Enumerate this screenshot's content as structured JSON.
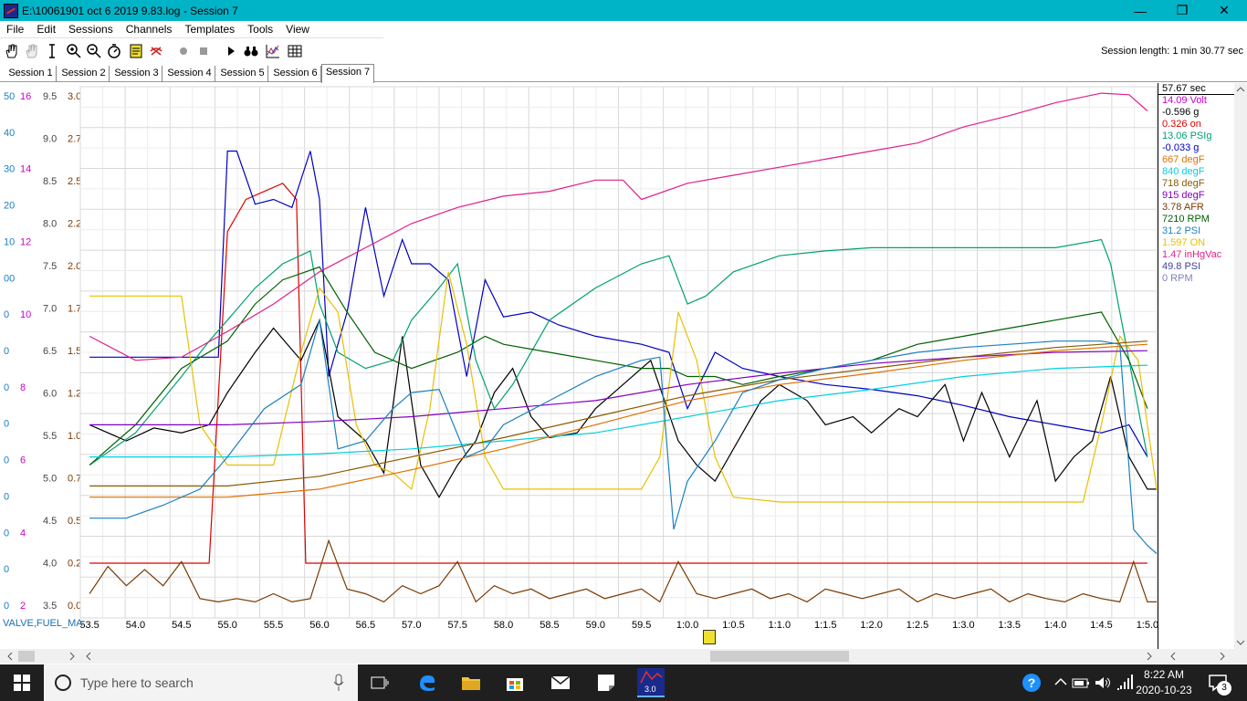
{
  "window": {
    "title": "E:\\10061901 oct 6 2019 9.83.log - Session 7",
    "min": "—",
    "max": "❐",
    "close": "✕"
  },
  "menu": [
    "File",
    "Edit",
    "Sessions",
    "Channels",
    "Templates",
    "Tools",
    "View"
  ],
  "toolbar": {
    "icons": [
      "hand-icon",
      "hand-disabled-icon",
      "cursor-icon",
      "zoom-in-icon",
      "zoom-out-icon",
      "stopwatch-icon",
      "note-icon",
      "clear-icon",
      "record-icon",
      "stop-icon",
      "play-icon",
      "binoculars-icon",
      "chart-icon",
      "table-icon"
    ],
    "session_length": "Session length:  1 min 30.77 sec"
  },
  "tabs": [
    "Session 1",
    "Session 2",
    "Session 3",
    "Session 4",
    "Session 5",
    "Session 6",
    "Session 7"
  ],
  "active_tab": 6,
  "legend": {
    "header": "57.67 sec",
    "entries": [
      {
        "text": "14.09 Volt",
        "color": "#cc00cc"
      },
      {
        "text": "-0.596 g",
        "color": "#000000"
      },
      {
        "text": "0.326 on",
        "color": "#dd0000"
      },
      {
        "text": "13.06 PSIg",
        "color": "#00a070"
      },
      {
        "text": "-0.033 g",
        "color": "#0000c0"
      },
      {
        "text": "667 degF",
        "color": "#e07000"
      },
      {
        "text": "840 degF",
        "color": "#00d0e0"
      },
      {
        "text": "718 degF",
        "color": "#8b5a00"
      },
      {
        "text": "915 degF",
        "color": "#8000c0"
      },
      {
        "text": "3.78 AFR",
        "color": "#7a3a00"
      },
      {
        "text": "7210 RPM",
        "color": "#006000"
      },
      {
        "text": "31.2 PSI",
        "color": "#1a80c0"
      },
      {
        "text": "1.597 ON",
        "color": "#e8c000"
      },
      {
        "text": "1.47 inHgVac",
        "color": "#e0208a"
      },
      {
        "text": "49.8 PSI",
        "color": "#4040a0"
      },
      {
        "text": "0 RPM",
        "color": "#8080c0"
      }
    ]
  },
  "channel_label": "VALVE,FUEL_MA",
  "chart_data": {
    "type": "line",
    "x_ticks": [
      "53.5",
      "54.0",
      "54.5",
      "55.0",
      "55.5",
      "56.0",
      "56.5",
      "57.0",
      "57.5",
      "58.0",
      "58.5",
      "59.0",
      "59.5",
      "1:0.0",
      "1:0.5",
      "1:1.0",
      "1:1.5",
      "1:2.0",
      "1:2.5",
      "1:3.0",
      "1:3.5",
      "1:4.0",
      "1:4.5",
      "1:5.0"
    ],
    "xlim": [
      53.4,
      65.1
    ],
    "axes": [
      {
        "color": "#1a80c0",
        "ticks": [
          "50",
          "40",
          "30",
          "20",
          "10",
          "00",
          "0",
          "0",
          "0",
          "0",
          "0",
          "0",
          "0",
          "0",
          "0"
        ]
      },
      {
        "color": "#cc00cc",
        "ticks": [
          "16",
          "14",
          "12",
          "10",
          "8",
          "6",
          "4",
          "2"
        ]
      },
      {
        "color": "#444444",
        "ticks": [
          "9.5",
          "9.0",
          "8.5",
          "8.0",
          "7.5",
          "7.0",
          "6.5",
          "6.0",
          "5.5",
          "5.0",
          "4.5",
          "4.0",
          "3.5"
        ]
      },
      {
        "color": "#7a3a00",
        "ticks": [
          "3.0",
          "2.7",
          "2.5",
          "2.2",
          "2.0",
          "1.7",
          "1.5",
          "1.2",
          "1.0",
          "0.7",
          "0.5",
          "0.2",
          "0.0"
        ]
      }
    ],
    "series": [
      {
        "color": "#cc00cc",
        "x": [
          53.5,
          54.0,
          55.0,
          56.0,
          57.0,
          57.5,
          58.0,
          59.0,
          59.5,
          60.0,
          61.0,
          62.0,
          63.0,
          64.0,
          64.5,
          65.0
        ],
        "y": [
          14.1,
          14.1,
          14.1,
          14.1,
          14.1,
          14.1,
          14.1,
          14.1,
          14.1,
          14.1,
          14.1,
          14.1,
          14.1,
          14.1,
          14.1,
          14.1
        ]
      },
      {
        "color": "#dd0000",
        "x": [
          53.5,
          54.5,
          54.8,
          55.0,
          55.2,
          55.6,
          55.75,
          55.85,
          56.0,
          57.0,
          58.0,
          59.0,
          60.0,
          61.0,
          62.0,
          63.0,
          64.0,
          65.0
        ],
        "y": [
          0.34,
          0.34,
          0.34,
          2.4,
          2.6,
          2.7,
          2.6,
          0.34,
          0.34,
          0.34,
          0.34,
          0.34,
          0.34,
          0.34,
          0.34,
          0.34,
          0.34,
          0.34
        ]
      },
      {
        "color": "#0000c0",
        "x": [
          53.5,
          54.5,
          54.9,
          55.0,
          55.1,
          55.3,
          55.5,
          55.7,
          55.9,
          56.0,
          56.1,
          56.3,
          56.5,
          56.7,
          56.9,
          57.0,
          57.2,
          57.4,
          57.6,
          57.8,
          58.0,
          58.3,
          58.6,
          59.0,
          59.5,
          59.8,
          60.0,
          60.3,
          60.6,
          61.0,
          61.5,
          62.0,
          62.5,
          63.0,
          63.5,
          64.0,
          64.5,
          64.8,
          65.0
        ],
        "y": [
          1.62,
          1.62,
          1.62,
          2.9,
          2.9,
          2.57,
          2.6,
          2.55,
          2.9,
          2.6,
          1.5,
          1.9,
          2.55,
          2.0,
          2.35,
          2.2,
          2.2,
          2.1,
          1.5,
          2.1,
          1.87,
          1.9,
          1.82,
          1.75,
          1.7,
          1.65,
          1.3,
          1.65,
          1.55,
          1.5,
          1.45,
          1.42,
          1.38,
          1.32,
          1.25,
          1.2,
          1.15,
          1.2,
          1.0
        ]
      },
      {
        "color": "#000000",
        "x": [
          53.5,
          53.9,
          54.2,
          54.5,
          54.8,
          55.0,
          55.3,
          55.5,
          55.8,
          56.0,
          56.2,
          56.5,
          56.7,
          56.9,
          57.1,
          57.3,
          57.5,
          57.7,
          57.9,
          58.1,
          58.3,
          58.5,
          58.8,
          59.0,
          59.3,
          59.6,
          59.9,
          60.1,
          60.3,
          60.6,
          60.8,
          61.0,
          61.3,
          61.5,
          61.8,
          62.0,
          62.3,
          62.5,
          62.8,
          63.0,
          63.2,
          63.5,
          63.8,
          64.0,
          64.2,
          64.4,
          64.6,
          64.8,
          65.0,
          65.1
        ],
        "y": [
          1.2,
          1.1,
          1.18,
          1.15,
          1.2,
          1.4,
          1.65,
          1.8,
          1.6,
          1.85,
          1.25,
          1.1,
          0.9,
          1.75,
          0.95,
          0.75,
          0.95,
          1.1,
          1.4,
          1.55,
          1.25,
          1.12,
          1.15,
          1.3,
          1.45,
          1.6,
          1.1,
          0.95,
          0.85,
          1.15,
          1.35,
          1.45,
          1.35,
          1.2,
          1.25,
          1.15,
          1.3,
          1.25,
          1.45,
          1.1,
          1.4,
          1.0,
          1.35,
          0.85,
          1.0,
          1.1,
          1.5,
          1.0,
          0.8,
          0.8
        ]
      },
      {
        "color": "#00a070",
        "x": [
          53.5,
          54.0,
          54.5,
          54.8,
          55.0,
          55.3,
          55.6,
          55.9,
          56.0,
          56.2,
          56.5,
          56.8,
          57.0,
          57.3,
          57.5,
          57.7,
          57.9,
          58.1,
          58.5,
          59.0,
          59.5,
          59.8,
          60.0,
          60.2,
          60.5,
          61.0,
          61.5,
          62.0,
          62.5,
          63.0,
          63.5,
          64.0,
          64.5,
          64.6,
          64.8,
          65.0
        ],
        "y": [
          0.95,
          1.15,
          1.5,
          1.72,
          1.85,
          2.05,
          2.2,
          2.28,
          1.95,
          1.65,
          1.55,
          1.6,
          1.85,
          2.05,
          2.2,
          1.6,
          1.3,
          1.45,
          1.85,
          2.05,
          2.2,
          2.25,
          1.95,
          2.0,
          2.15,
          2.25,
          2.28,
          2.3,
          2.3,
          2.3,
          2.3,
          2.3,
          2.35,
          2.2,
          1.6,
          1.0
        ]
      },
      {
        "color": "#006000",
        "x": [
          53.5,
          54.0,
          54.5,
          55.0,
          55.3,
          55.6,
          56.0,
          56.3,
          56.6,
          57.0,
          57.5,
          57.8,
          58.0,
          58.5,
          59.0,
          59.5,
          59.8,
          60.0,
          60.3,
          60.6,
          61.0,
          61.5,
          62.0,
          62.5,
          63.0,
          63.5,
          64.0,
          64.5,
          64.8,
          65.0
        ],
        "y": [
          0.95,
          1.2,
          1.55,
          1.72,
          1.95,
          2.1,
          2.18,
          1.9,
          1.65,
          1.55,
          1.65,
          1.75,
          1.7,
          1.65,
          1.6,
          1.55,
          1.55,
          1.5,
          1.5,
          1.45,
          1.5,
          1.55,
          1.6,
          1.7,
          1.75,
          1.8,
          1.85,
          1.9,
          1.6,
          1.3
        ]
      },
      {
        "color": "#e8c000",
        "x": [
          53.5,
          54.0,
          54.5,
          54.7,
          55.0,
          55.5,
          55.8,
          56.0,
          56.2,
          56.4,
          56.6,
          56.8,
          57.0,
          57.2,
          57.4,
          57.6,
          57.8,
          58.0,
          58.5,
          59.0,
          59.5,
          59.7,
          59.9,
          60.1,
          60.3,
          60.5,
          61.0,
          61.5,
          62.0,
          62.5,
          63.0,
          63.5,
          64.0,
          64.3,
          64.5,
          64.7,
          64.9,
          65.0,
          65.1
        ],
        "y": [
          2.0,
          2.0,
          2.0,
          1.2,
          0.95,
          0.95,
          1.65,
          2.05,
          1.9,
          1.2,
          0.95,
          0.9,
          0.8,
          1.3,
          2.15,
          1.7,
          1.0,
          0.8,
          0.8,
          0.8,
          0.8,
          1.0,
          1.9,
          1.6,
          1.0,
          0.75,
          0.72,
          0.72,
          0.72,
          0.72,
          0.72,
          0.72,
          0.72,
          0.72,
          1.2,
          1.75,
          1.6,
          1.2,
          0.8
        ]
      },
      {
        "color": "#e0208a",
        "x": [
          53.5,
          54.0,
          54.5,
          55.0,
          55.5,
          56.0,
          56.5,
          57.0,
          57.5,
          58.0,
          58.5,
          59.0,
          59.3,
          59.5,
          60.0,
          60.5,
          61.0,
          61.5,
          62.0,
          62.5,
          63.0,
          63.5,
          64.0,
          64.5,
          64.8,
          65.0
        ],
        "y": [
          1.75,
          1.6,
          1.62,
          1.78,
          1.95,
          2.15,
          2.3,
          2.45,
          2.55,
          2.62,
          2.65,
          2.72,
          2.72,
          2.6,
          2.7,
          2.75,
          2.8,
          2.85,
          2.9,
          2.95,
          3.05,
          3.12,
          3.2,
          3.26,
          3.25,
          3.15
        ]
      },
      {
        "color": "#8000c0",
        "x": [
          53.5,
          54.0,
          55.0,
          56.0,
          57.0,
          58.0,
          59.0,
          60.0,
          61.0,
          62.0,
          63.0,
          64.0,
          65.0
        ],
        "y": [
          1.2,
          1.2,
          1.2,
          1.22,
          1.25,
          1.3,
          1.35,
          1.45,
          1.52,
          1.58,
          1.62,
          1.65,
          1.66
        ]
      },
      {
        "color": "#00d0e0",
        "x": [
          53.5,
          54.0,
          55.0,
          56.0,
          57.0,
          58.0,
          59.0,
          60.0,
          61.0,
          62.0,
          63.0,
          64.0,
          65.0
        ],
        "y": [
          1.0,
          1.0,
          1.0,
          1.02,
          1.05,
          1.1,
          1.15,
          1.25,
          1.35,
          1.42,
          1.5,
          1.55,
          1.57
        ]
      },
      {
        "color": "#8b5a00",
        "x": [
          53.5,
          54.0,
          55.0,
          56.0,
          57.0,
          58.0,
          59.0,
          60.0,
          61.0,
          62.0,
          63.0,
          64.0,
          65.0
        ],
        "y": [
          0.82,
          0.82,
          0.82,
          0.88,
          1.0,
          1.12,
          1.25,
          1.38,
          1.48,
          1.55,
          1.62,
          1.68,
          1.72
        ]
      },
      {
        "color": "#e07000",
        "x": [
          53.5,
          54.0,
          55.0,
          56.0,
          57.0,
          58.0,
          59.0,
          60.0,
          61.0,
          62.0,
          63.0,
          64.0,
          65.0
        ],
        "y": [
          0.75,
          0.75,
          0.75,
          0.8,
          0.92,
          1.05,
          1.2,
          1.35,
          1.45,
          1.52,
          1.6,
          1.66,
          1.7
        ]
      },
      {
        "color": "#1a80c0",
        "x": [
          53.5,
          53.9,
          54.3,
          54.7,
          55.0,
          55.4,
          55.8,
          56.0,
          56.2,
          56.5,
          56.8,
          57.0,
          57.3,
          57.6,
          57.8,
          58.0,
          58.5,
          59.0,
          59.5,
          59.7,
          59.85,
          60.0,
          60.3,
          60.6,
          61.0,
          61.5,
          62.0,
          62.5,
          63.0,
          63.5,
          64.0,
          64.5,
          64.7,
          64.85,
          65.0,
          65.1
        ],
        "y": [
          0.62,
          0.62,
          0.7,
          0.8,
          1.0,
          1.3,
          1.45,
          1.85,
          1.05,
          1.1,
          1.3,
          1.4,
          1.42,
          1.0,
          1.05,
          1.2,
          1.35,
          1.5,
          1.6,
          1.62,
          0.55,
          0.85,
          1.1,
          1.4,
          1.48,
          1.55,
          1.6,
          1.65,
          1.68,
          1.7,
          1.72,
          1.72,
          1.7,
          0.55,
          0.45,
          0.4
        ]
      },
      {
        "color": "#7a3a00",
        "x": [
          53.5,
          53.7,
          53.9,
          54.1,
          54.3,
          54.5,
          54.7,
          54.9,
          55.1,
          55.3,
          55.5,
          55.7,
          55.9,
          56.1,
          56.3,
          56.5,
          56.7,
          56.9,
          57.1,
          57.3,
          57.5,
          57.7,
          57.9,
          58.1,
          58.3,
          58.5,
          58.7,
          58.9,
          59.1,
          59.3,
          59.5,
          59.7,
          59.9,
          60.1,
          60.3,
          60.5,
          60.7,
          60.9,
          61.1,
          61.3,
          61.5,
          61.7,
          61.9,
          62.1,
          62.3,
          62.5,
          62.7,
          62.9,
          63.1,
          63.3,
          63.5,
          63.7,
          63.9,
          64.1,
          64.3,
          64.5,
          64.7,
          64.85,
          65.0,
          65.1
        ],
        "y": [
          0.15,
          0.32,
          0.2,
          0.3,
          0.2,
          0.35,
          0.12,
          0.1,
          0.12,
          0.1,
          0.15,
          0.1,
          0.12,
          0.48,
          0.18,
          0.15,
          0.1,
          0.2,
          0.15,
          0.2,
          0.35,
          0.1,
          0.2,
          0.15,
          0.18,
          0.12,
          0.15,
          0.18,
          0.12,
          0.15,
          0.18,
          0.1,
          0.35,
          0.15,
          0.12,
          0.15,
          0.18,
          0.12,
          0.15,
          0.1,
          0.18,
          0.15,
          0.12,
          0.15,
          0.18,
          0.1,
          0.15,
          0.12,
          0.15,
          0.18,
          0.1,
          0.15,
          0.12,
          0.1,
          0.15,
          0.12,
          0.1,
          0.35,
          0.1,
          0.1
        ]
      }
    ],
    "ylim": [
      0.0,
      3.3
    ],
    "grid": true
  },
  "taskbar": {
    "search_placeholder": "Type here to search",
    "time": "8:22 AM",
    "date": "2020-10-23",
    "notifications": "3",
    "app_label": "3.0"
  }
}
